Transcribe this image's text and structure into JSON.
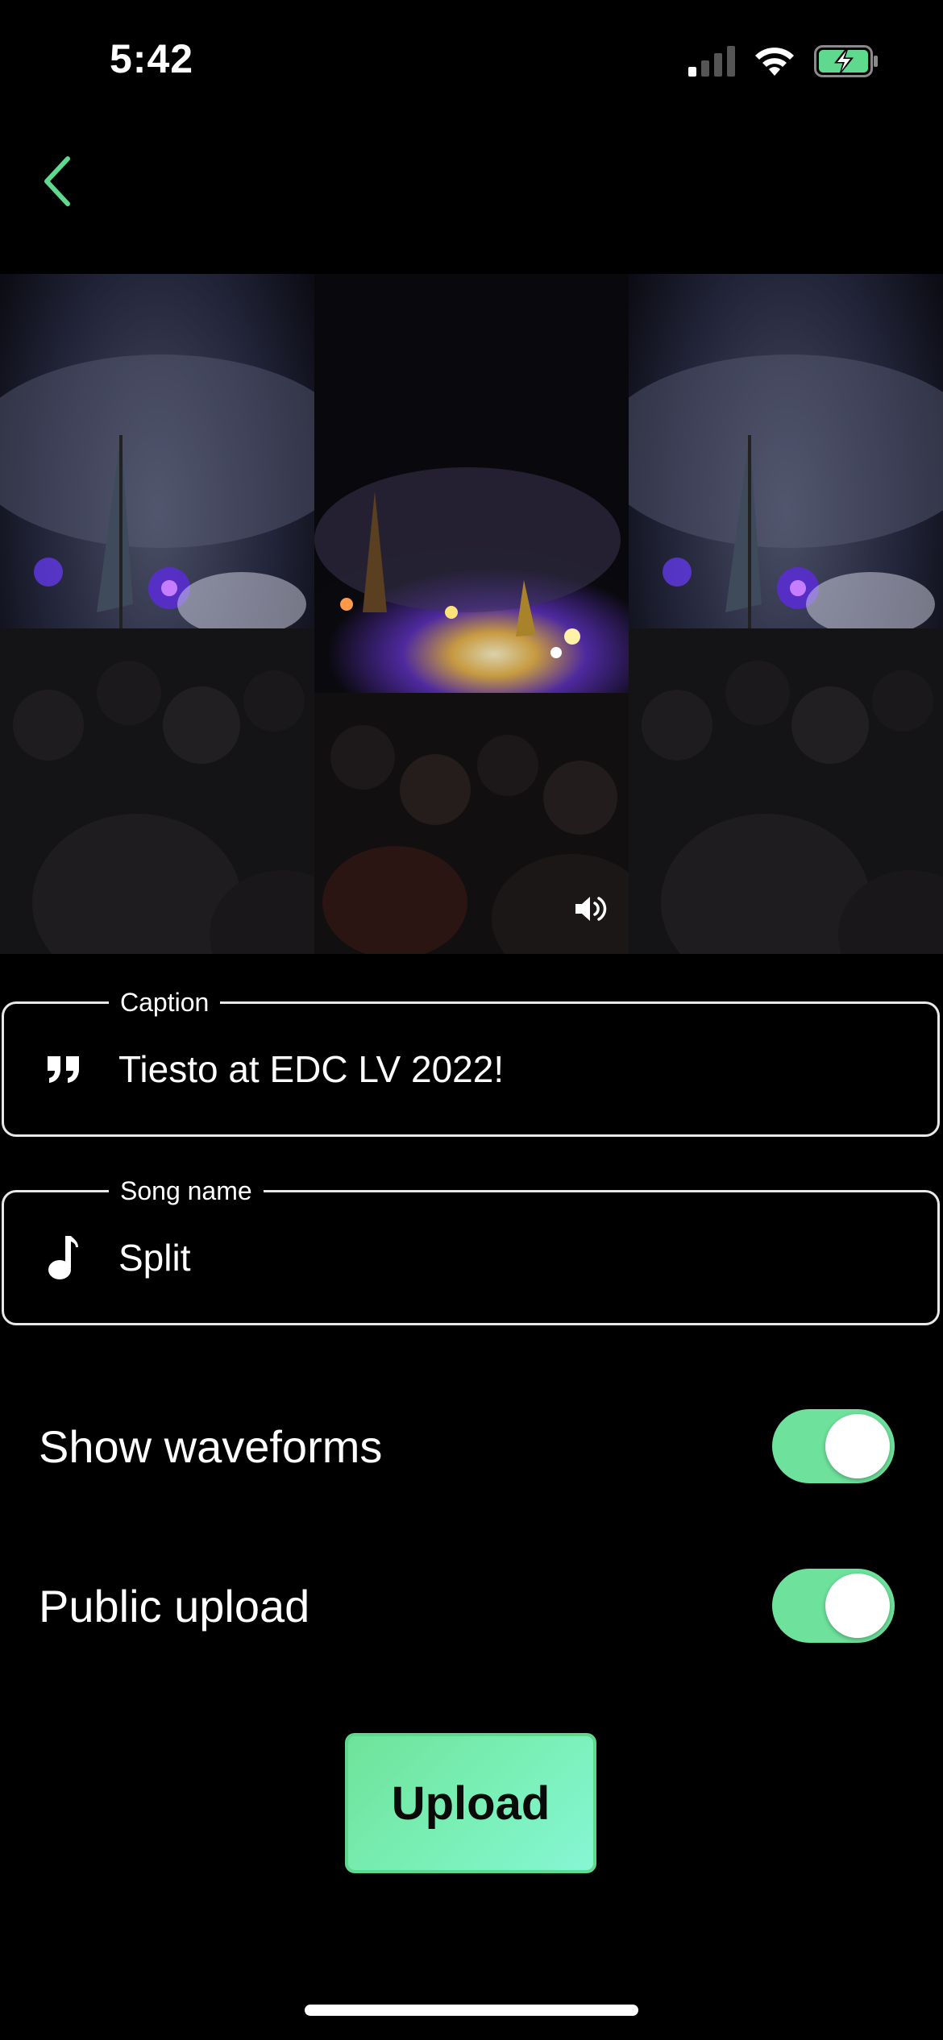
{
  "status_bar": {
    "time": "5:42",
    "icons": [
      "cellular-signal-icon",
      "wifi-icon",
      "battery-charging-icon"
    ]
  },
  "nav": {
    "back_icon": "chevron-left-icon",
    "accent": "#5fd98e"
  },
  "video": {
    "sound_icon": "speaker-icon"
  },
  "caption": {
    "label": "Caption",
    "value": "Tiesto at EDC LV 2022!",
    "icon": "quote-icon"
  },
  "song": {
    "label": "Song name",
    "value": "Split",
    "icon": "music-note-icon"
  },
  "settings": {
    "show_waveforms": {
      "label": "Show waveforms",
      "on": true
    },
    "public_upload": {
      "label": "Public upload",
      "on": true
    }
  },
  "upload": {
    "label": "Upload"
  },
  "colors": {
    "background": "#000000",
    "toggle_on": "#6ee29c",
    "button_gradient_start": "#6ee39a",
    "button_gradient_end": "#86f6d4"
  }
}
